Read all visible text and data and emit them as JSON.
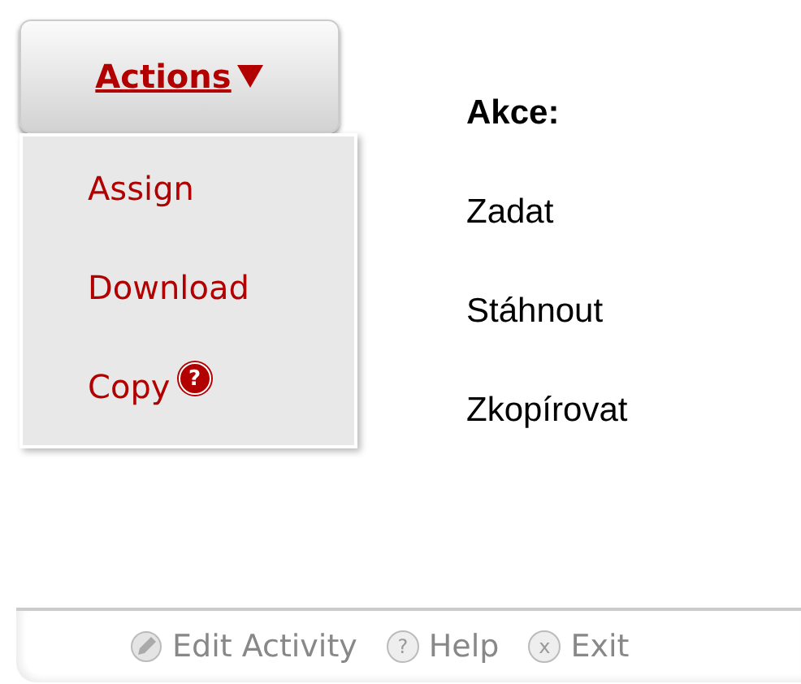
{
  "actions_button": {
    "label": "Actions",
    "expanded": true
  },
  "menu_items": [
    {
      "label": "Assign"
    },
    {
      "label": "Download"
    },
    {
      "label": "Copy",
      "help_icon": "?"
    }
  ],
  "translations": {
    "heading": "Akce:",
    "items": [
      "Zadat",
      "Stáhnout",
      "Zkopírovat"
    ]
  },
  "footer": [
    {
      "kind": "edit",
      "label": "Edit Activity"
    },
    {
      "kind": "help",
      "icon": "?",
      "label": "Help"
    },
    {
      "kind": "exit",
      "icon": "x",
      "label": "Exit"
    }
  ]
}
